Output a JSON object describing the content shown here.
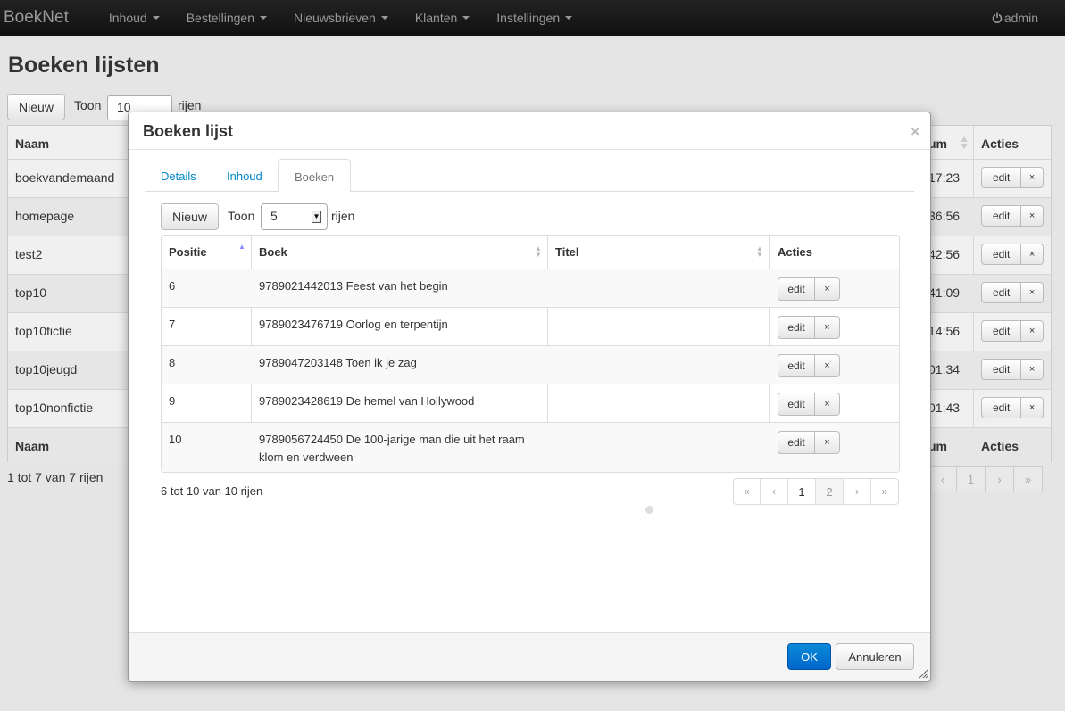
{
  "navbar": {
    "brand": "BoekNet",
    "items": [
      "Inhoud",
      "Bestellingen",
      "Nieuwsbrieven",
      "Klanten",
      "Instellingen"
    ],
    "user": "admin"
  },
  "background": {
    "title": "Boeken lijsten",
    "new_label": "Nieuw",
    "show_label": "Toon",
    "show_value": "10",
    "rows_label": "rijen",
    "columns": {
      "name": "Naam",
      "date_partial": "um",
      "actions": "Acties"
    },
    "rows": [
      {
        "name": "boekvandemaand",
        "time": "17:23"
      },
      {
        "name": "homepage",
        "time": "36:56"
      },
      {
        "name": "test2",
        "time": "42:56"
      },
      {
        "name": "top10",
        "time": "41:09"
      },
      {
        "name": "top10fictie",
        "time": "14:56"
      },
      {
        "name": "top10jeugd",
        "time": "01:34"
      },
      {
        "name": "top10nonfictie",
        "time": "01:43"
      }
    ],
    "edit_label": "edit",
    "delete_label": "×",
    "info": "1 tot 7 van 7 rijen",
    "pager": [
      "‹",
      "1",
      "›",
      "»"
    ]
  },
  "modal": {
    "title": "Boeken lijst",
    "close": "×",
    "tabs": [
      "Details",
      "Inhoud",
      "Boeken"
    ],
    "active_tab": "Boeken",
    "new_label": "Nieuw",
    "show_label": "Toon",
    "show_value": "5",
    "rows_label": "rijen",
    "columns": [
      "Positie",
      "Boek",
      "Titel",
      "Acties"
    ],
    "rows": [
      {
        "pos": "6",
        "book": "9789021442013 Feest van het begin",
        "title": ""
      },
      {
        "pos": "7",
        "book": "9789023476719 Oorlog en terpentijn",
        "title": ""
      },
      {
        "pos": "8",
        "book": "9789047203148 Toen ik je zag",
        "title": ""
      },
      {
        "pos": "9",
        "book": "9789023428619 De hemel van Hollywood",
        "title": ""
      },
      {
        "pos": "10",
        "book": "9789056724450 De 100-jarige man die uit het raam klom en verdween",
        "title": ""
      }
    ],
    "edit_label": "edit",
    "delete_label": "×",
    "info": "6 tot 10 van 10 rijen",
    "pager": [
      "«",
      "‹",
      "1",
      "2",
      "›",
      "»"
    ],
    "ok_label": "OK",
    "cancel_label": "Annuleren"
  }
}
